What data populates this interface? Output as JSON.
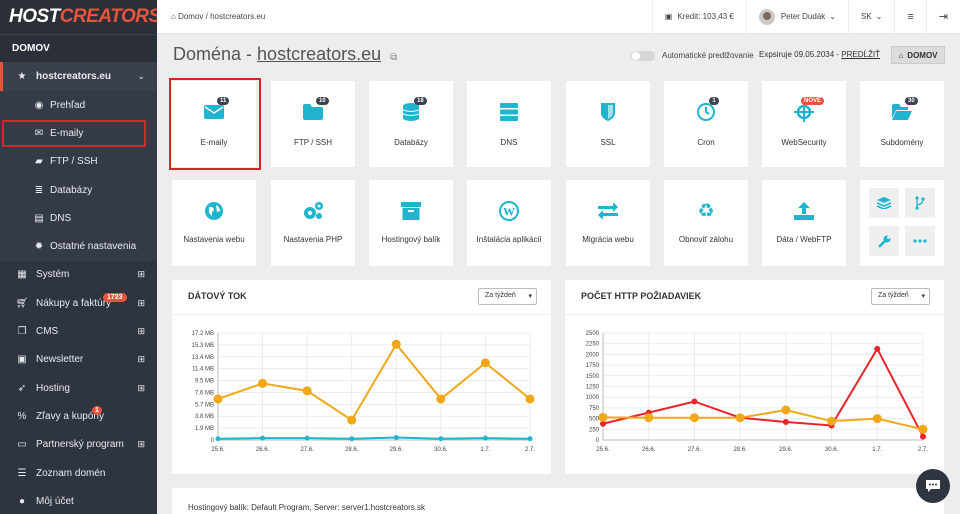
{
  "brand": {
    "logo_part1": "HOST",
    "logo_part2": "CREATORS",
    "accent": "#e8543b",
    "primary": "#1fb5cf"
  },
  "sidebar": {
    "section_label": "DOMOV",
    "domain": "hostcreators.eu",
    "sub_items": [
      {
        "label": "Prehľad",
        "icon": "globe-icon"
      },
      {
        "label": "E-maily",
        "icon": "envelope-icon"
      },
      {
        "label": "FTP / SSH",
        "icon": "folder-icon"
      },
      {
        "label": "Databázy",
        "icon": "database-icon"
      },
      {
        "label": "DNS",
        "icon": "server-icon"
      },
      {
        "label": "Ostatné nastavenia",
        "icon": "gear-icon"
      }
    ],
    "main_items": [
      {
        "label": "Systém",
        "icon": "grid-icon"
      },
      {
        "label": "Nákupy a faktúry",
        "icon": "cart-icon",
        "badge": "1723"
      },
      {
        "label": "CMS",
        "icon": "copy-icon"
      },
      {
        "label": "Newsletter",
        "icon": "newspaper-icon"
      },
      {
        "label": "Hosting",
        "icon": "rocket-icon"
      },
      {
        "label": "Zľavy a kupóny",
        "icon": "percent-icon",
        "badge": "1"
      },
      {
        "label": "Partnerský program",
        "icon": "id-card-icon"
      },
      {
        "label": "Zoznam domén",
        "icon": "list-icon"
      },
      {
        "label": "Môj účet",
        "icon": "user-icon"
      }
    ]
  },
  "topbar": {
    "breadcrumb_home": "Domov",
    "breadcrumb_domain": "hostcreators.eu",
    "credit": "Kredit: 103,43 €",
    "user": "Peter Dudák",
    "lang": "SK"
  },
  "header": {
    "title_prefix": "Doména -",
    "title_domain": "hostcreators.eu",
    "auto_renew_label": "Automatické predlžovanie",
    "expiry_text": "Expsiruje 09.05.2034 -",
    "renew_link": "PREDĹŽIŤ",
    "home_button": "DOMOV"
  },
  "tiles_row1": [
    {
      "label": "E-maily",
      "badge": "11",
      "icon": "envelope-icon"
    },
    {
      "label": "FTP / SSH",
      "badge": "10",
      "icon": "folder-icon"
    },
    {
      "label": "Databázy",
      "badge": "18",
      "icon": "database-icon"
    },
    {
      "label": "DNS",
      "icon": "server-icon"
    },
    {
      "label": "SSL",
      "icon": "shield-icon"
    },
    {
      "label": "Cron",
      "badge": "1",
      "icon": "clock-icon"
    },
    {
      "label": "WebSecurity",
      "badge": "NOVÉ",
      "icon": "crosshair-icon"
    },
    {
      "label": "Subdomény",
      "badge": "30",
      "icon": "folder-open-icon"
    }
  ],
  "tiles_row2": [
    {
      "label": "Nastavenia webu",
      "icon": "globe-icon"
    },
    {
      "label": "Nastavenia PHP",
      "icon": "gears-icon"
    },
    {
      "label": "Hostingový balík",
      "icon": "box-icon"
    },
    {
      "label": "Inštalácia aplikácií",
      "icon": "wordpress-icon"
    },
    {
      "label": "Migrácia webu",
      "icon": "exchange-icon"
    },
    {
      "label": "Obnoviť zálohu",
      "icon": "recycle-icon"
    },
    {
      "label": "Dáta / WebFTP",
      "icon": "upload-icon"
    }
  ],
  "tools": [
    "layers-icon",
    "branch-icon",
    "wrench-icon",
    "more-icon"
  ],
  "panels": {
    "traffic_title": "DÁTOVÝ TOK",
    "http_title": "POČET HTTP POŽIADAVIEK",
    "range_option": "Za týždeň"
  },
  "chart_data": [
    {
      "type": "line",
      "title": "DÁTOVÝ TOK",
      "categories": [
        "25.6.",
        "26.6.",
        "27.6.",
        "28.6.",
        "29.6.",
        "30.6.",
        "1.7.",
        "2.7."
      ],
      "y_ticks": [
        "0",
        "1.9 MB",
        "3.8 MB",
        "5.7 MB",
        "7.6 MB",
        "9.5 MB",
        "11.4 MB",
        "13.4 MB",
        "15.3 MB",
        "17.2 MB"
      ],
      "ylim": [
        0,
        17.2
      ],
      "series": [
        {
          "color": "#f0a818",
          "values": [
            6.6,
            9.1,
            7.9,
            3.2,
            15.4,
            6.6,
            12.4,
            6.6
          ]
        },
        {
          "color": "#1fb5cf",
          "values": [
            0.2,
            0.3,
            0.3,
            0.2,
            0.4,
            0.2,
            0.3,
            0.2
          ]
        }
      ]
    },
    {
      "type": "line",
      "title": "POČET HTTP POŽIADAVIEK",
      "categories": [
        "25.6.",
        "26.6.",
        "27.6.",
        "28.6.",
        "29.6.",
        "30.6.",
        "1.7.",
        "2.7."
      ],
      "y_ticks": [
        "0",
        "250",
        "500",
        "750",
        "1000",
        "1250",
        "1500",
        "1750",
        "2000",
        "2250",
        "2500"
      ],
      "ylim": [
        0,
        2500
      ],
      "series": [
        {
          "color": "#e8252a",
          "values": [
            380,
            640,
            900,
            520,
            420,
            340,
            2130,
            80
          ]
        },
        {
          "color": "#f0a818",
          "values": [
            530,
            520,
            520,
            520,
            700,
            440,
            500,
            250
          ]
        }
      ]
    }
  ],
  "footer": {
    "info": "Hostingový balík: Default Program, Server: server1.hostcreators.sk"
  }
}
